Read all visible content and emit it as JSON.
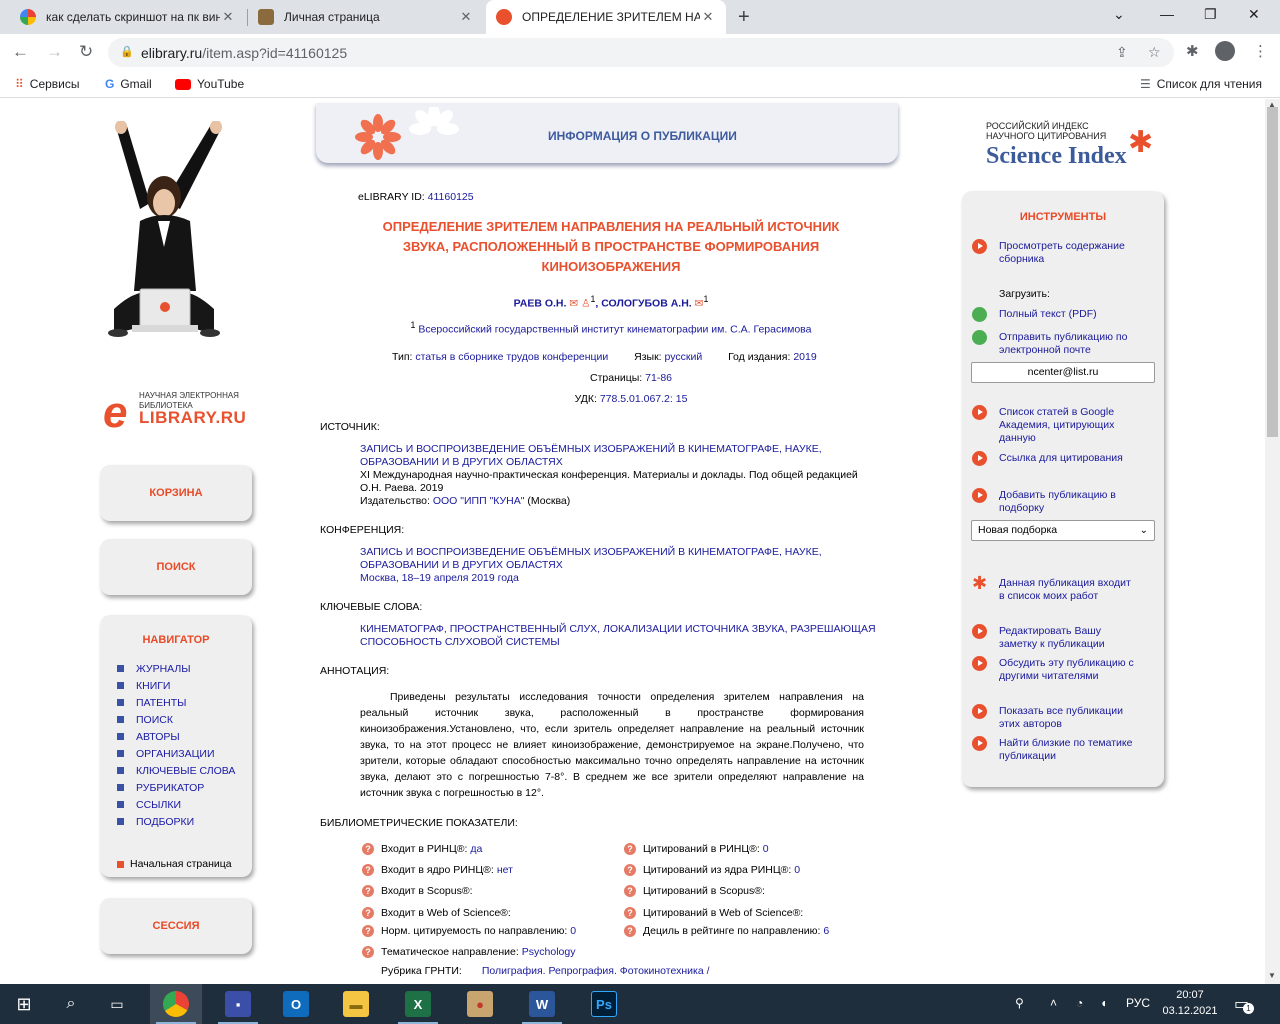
{
  "browser": {
    "tabs": [
      {
        "title": "как сделать скриншот на пк виндо"
      },
      {
        "title": "Личная страница"
      },
      {
        "title": "ОПРЕДЕЛЕНИЕ ЗРИТЕЛЕМ НАПРАВ"
      }
    ],
    "url_host": "elibrary.ru",
    "url_path": "/item.asp?id=41160125",
    "bookmarks": [
      "Сервисы",
      "Gmail",
      "YouTube"
    ],
    "reading_list": "Список для чтения"
  },
  "left": {
    "logo_small": "НАУЧНАЯ ЭЛЕКТРОННАЯ БИБЛИОТЕКА",
    "logo_big": "LIBRARY.RU",
    "cart": "КОРЗИНА",
    "search": "ПОИСК",
    "navigator_title": "НАВИГАТОР",
    "nav_items": [
      "ЖУРНАЛЫ",
      "КНИГИ",
      "ПАТЕНТЫ",
      "ПОИСК",
      "АВТОРЫ",
      "ОРГАНИЗАЦИИ",
      "КЛЮЧЕВЫЕ СЛОВА",
      "РУБРИКАТОР",
      "ССЫЛКИ",
      "ПОДБОРКИ"
    ],
    "home": "Начальная страница",
    "session": "СЕССИЯ"
  },
  "banner": {
    "title": "ИНФОРМАЦИЯ О ПУБЛИКАЦИИ"
  },
  "pub": {
    "id_label": "eLIBRARY ID:",
    "id_value": "41160125",
    "title": [
      "ОПРЕДЕЛЕНИЕ ЗРИТЕЛЕМ НАПРАВЛЕНИЯ НА РЕАЛЬНЫЙ ИСТОЧНИК",
      "ЗВУКА, РАСПОЛОЖЕННЫЙ В ПРОСТРАНСТВЕ ФОРМИРОВАНИЯ",
      "КИНОИЗОБРАЖЕНИЯ"
    ],
    "author1": "РАЕВ О.Н.",
    "author2": "СОЛОГУБОВ А.Н.",
    "sup": "1",
    "affiliation": "Всероссийский государственный институт кинематографии им. С.А. Герасимова",
    "type_label": "Тип:",
    "type_value": "статья в сборнике трудов конференции",
    "lang_label": "Язык:",
    "lang_value": "русский",
    "year_label": "Год издания:",
    "year_value": "2019",
    "pages_label": "Страницы:",
    "pages_value": "71-86",
    "udk_label": "УДК:",
    "udk_value": "778.5.01.067.2: 15"
  },
  "source": {
    "label": "ИСТОЧНИК:",
    "title": [
      "ЗАПИСЬ И ВОСПРОИЗВЕДЕНИЕ ОБЪЁМНЫХ ИЗОБРАЖЕНИЙ В КИНЕМАТОГРАФЕ, НАУКЕ,",
      "ОБРАЗОВАНИИ И В ДРУГИХ ОБЛАСТЯХ"
    ],
    "desc": [
      "XI Международная научно-практическая конференция. Материалы и доклады. Под общей редакцией",
      "О.Н. Раева. 2019"
    ],
    "publisher_label": "Издательство:",
    "publisher": "ООО \"ИПП \"КУНА\"",
    "city": "(Москва)"
  },
  "conference": {
    "label": "КОНФЕРЕНЦИЯ:",
    "title": [
      "ЗАПИСЬ И ВОСПРОИЗВЕДЕНИЕ ОБЪЁМНЫХ ИЗОБРАЖЕНИЙ В КИНЕМАТОГРАФЕ, НАУКЕ,",
      "ОБРАЗОВАНИИ И В ДРУГИХ ОБЛАСТЯХ"
    ],
    "place": "Москва, 18–19 апреля 2019 года"
  },
  "keywords": {
    "label": "КЛЮЧЕВЫЕ СЛОВА:",
    "lines": [
      "КИНЕМАТОГРАФ, ПРОСТРАНСТВЕННЫЙ СЛУХ, ЛОКАЛИЗАЦИИ ИСТОЧНИКА ЗВУКА, РАЗРЕШАЮЩАЯ",
      "СПОСОБНОСТЬ СЛУХОВОЙ СИСТЕМЫ"
    ]
  },
  "annotation": {
    "label": "АННОТАЦИЯ:",
    "lines": [
      "Приведены результаты исследования точности определения зрителем направления на",
      "реальный источник звука, расположенный в пространстве формирования",
      "киноизображения.Установлено, что, если зритель определяет направление на реальный источник",
      "звука, то на этот процесс не влияет киноизображение, демонстрируемое на экране.Получено, что",
      "зрители, которые обладают способностью максимально точно определять направление на источник",
      "звука, делают это с погрешностью 7-8°. В среднем же все зрители определяют направление на",
      "источник звука с погрешностью в 12°."
    ]
  },
  "biblio": {
    "label": "БИБЛИОМЕТРИЧЕСКИЕ ПОКАЗАТЕЛИ:",
    "left": [
      {
        "label": "Входит в РИНЦ®:",
        "value": "да"
      },
      {
        "label": "Входит в ядро РИНЦ®:",
        "value": "нет"
      },
      {
        "label": "Входит в Scopus®:",
        "value": ""
      },
      {
        "label": "Входит в Web of Science®:",
        "value": ""
      },
      {
        "label": "Норм. цитируемость по направлению:",
        "value": "0"
      },
      {
        "label": "Тематическое направление:",
        "value": "Psychology"
      },
      {
        "label": "Рубрика ГРНТИ:",
        "value": "Полиграфия. Репрография. Фотокинотехника /"
      }
    ],
    "right": [
      {
        "label": "Цитирований в РИНЦ®:",
        "value": "0"
      },
      {
        "label": "Цитирований из ядра РИНЦ®:",
        "value": "0"
      },
      {
        "label": "Цитирований в Scopus®:",
        "value": ""
      },
      {
        "label": "Цитирований в Web of Science®:",
        "value": ""
      },
      {
        "label": "Дециль в рейтинге по направлению:",
        "value": "6"
      }
    ]
  },
  "science_index": {
    "small": [
      "РОССИЙСКИЙ ИНДЕКС",
      "НАУЧНОГО ЦИТИРОВАНИЯ"
    ],
    "big": "Science Index"
  },
  "tools": {
    "title": "ИНСТРУМЕНТЫ",
    "view_contents": "Просмотреть содержание сборника",
    "download_label": "Загрузить:",
    "full_text": "Полный текст (PDF)",
    "send_email": "Отправить публикацию по электронной почте",
    "email_value": "ncenter@list.ru",
    "google_scholar": "Список статей в Google Академия, цитирующих данную",
    "cite_link": "Ссылка для цитирования",
    "add_collection": "Добавить публикацию в подборку",
    "collection_select": "Новая подборка",
    "in_my_works": "Данная публикация входит в список моих работ",
    "edit_note": "Редактировать Вашу заметку к публикации",
    "discuss": "Обсудить эту публикацию с другими читателями",
    "show_all": "Показать все публикации этих авторов",
    "find_similar": "Найти близкие по тематике публикации"
  },
  "taskbar": {
    "lang": "РУС",
    "time": "20:07",
    "date": "03.12.2021",
    "notif": "1"
  }
}
